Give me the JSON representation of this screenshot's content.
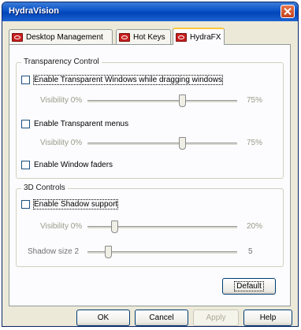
{
  "window": {
    "title": "HydraVision"
  },
  "tabs": [
    {
      "label": "Desktop Management",
      "icon": "hydravision-icon"
    },
    {
      "label": "Hot Keys",
      "icon": "hydravision-icon"
    },
    {
      "label": "HydraFX",
      "icon": "hydravision-icon",
      "active": true
    }
  ],
  "transparency": {
    "group_label": "Transparency Control",
    "drag_checkbox": {
      "label": "Enable Transparent Windows while dragging windows",
      "checked": false
    },
    "drag_slider": {
      "label": "Visibility 0%",
      "max": "75%",
      "level_percent": 60
    },
    "menus_checkbox": {
      "label": "Enable Transparent menus",
      "checked": false
    },
    "menus_slider": {
      "label": "Visibility 0%",
      "max": "75%",
      "level_percent": 60
    },
    "faders_checkbox": {
      "label": "Enable Window faders",
      "checked": false
    }
  },
  "controls3d": {
    "group_label": "3D Controls",
    "shadow_checkbox": {
      "label": "Enable Shadow support",
      "checked": false
    },
    "shadow_visibility": {
      "label": "Visibility 0%",
      "max": "20%",
      "level_percent": 8
    },
    "shadow_size": {
      "label": "Shadow size 2",
      "max": "5",
      "level_value": 2
    }
  },
  "buttons": {
    "default": "Default",
    "ok": "OK",
    "cancel": "Cancel",
    "apply": "Apply",
    "help": "Help"
  },
  "colors": {
    "titlebar": "#0a52c8",
    "accent_tab": "#ffc83c",
    "icon_red": "#c81e1e"
  }
}
